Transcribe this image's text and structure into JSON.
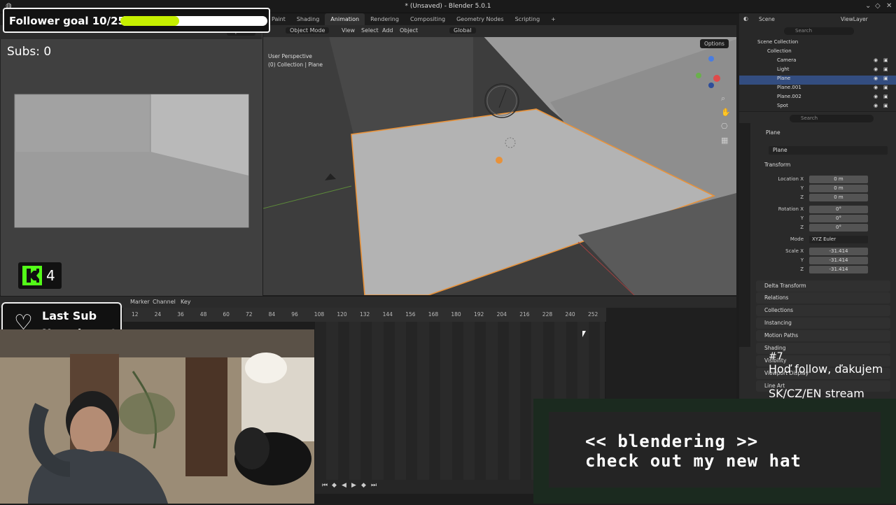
{
  "window": {
    "title": "* (Unsaved) - Blender 5.0.1"
  },
  "workspace_tabs": [
    "Paint",
    "Shading",
    "Animation",
    "Rendering",
    "Compositing",
    "Geometry Nodes",
    "Scripting",
    "+"
  ],
  "active_tab": "Animation",
  "camera_view": {
    "options_label": "Options"
  },
  "viewport": {
    "mode": "Object Mode",
    "menus": [
      "View",
      "Select",
      "Add",
      "Object"
    ],
    "transform_orientation": "Global",
    "options_label": "Options",
    "overlay_line1": "User Perspective",
    "overlay_line2": "(0) Collection | Plane"
  },
  "outliner": {
    "scene_label": "Scene",
    "viewlayer_label": "ViewLayer",
    "search_placeholder": "Search",
    "root": "Scene Collection",
    "collection": "Collection",
    "items": [
      "Camera",
      "Light",
      "Plane",
      "Plane.001",
      "Plane.002",
      "Spot"
    ],
    "selected": "Plane"
  },
  "properties": {
    "search_placeholder": "Search",
    "object_name": "Plane",
    "object_field": "Plane",
    "transform_label": "Transform",
    "location_label": "Location X",
    "location": [
      "0 m",
      "0 m",
      "0 m"
    ],
    "rotation_label": "Rotation X",
    "rotation": [
      "0°",
      "0°",
      "0°"
    ],
    "mode_label": "Mode",
    "mode_value": "XYZ Euler",
    "scale_label": "Scale X",
    "scale": [
      "-31.414",
      "-31.414",
      "-31.414"
    ],
    "axis_y": "Y",
    "axis_z": "Z",
    "sections": [
      "Delta Transform",
      "Relations",
      "Collections",
      "Instancing",
      "Motion Paths",
      "Shading",
      "Visibility",
      "Viewport Display",
      "Line Art"
    ]
  },
  "timeline": {
    "menus": [
      "Marker",
      "Channel",
      "Key"
    ],
    "frames": [
      "12",
      "24",
      "36",
      "48",
      "60",
      "72",
      "84",
      "96",
      "108",
      "120",
      "132",
      "144",
      "156",
      "168",
      "180",
      "192",
      "204",
      "216",
      "228",
      "240",
      "252"
    ]
  },
  "overlay": {
    "follower_goal_text": "Follower goal 10/25",
    "follower_progress": 0.4,
    "subs_text": "Subs: 0",
    "kick_count": "4",
    "last_sub_title": "Last Sub",
    "last_sub_value": "No subs yet",
    "ticker_number": "#7",
    "ticker_line1": "Hoď follow, ďakujem",
    "ticker_line2": "SK/CZ/EN stream",
    "banner_line1": "<< blendering >>",
    "banner_line2": "check out my new hat"
  },
  "colors": {
    "accent_selection": "#334d80",
    "goal_fill": "#c6f000",
    "kick_green": "#53fc18",
    "outline_orange": "#e8923a"
  }
}
